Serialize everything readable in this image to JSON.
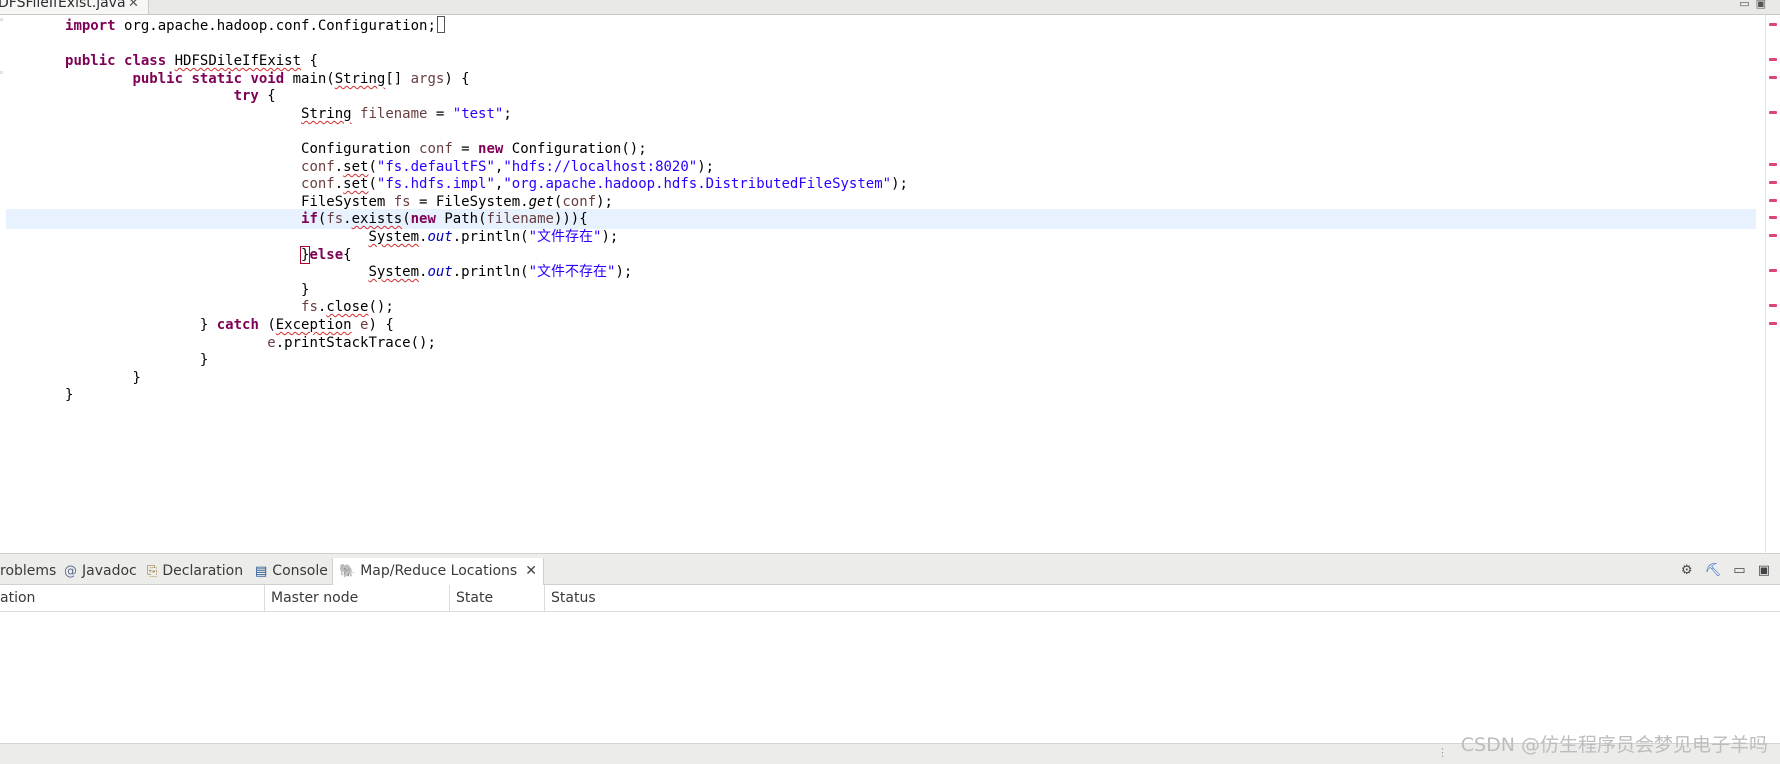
{
  "editor": {
    "tab_label": "DFSFileIfExist.java",
    "close_glyph": "✕",
    "min_max_glyphs": "▭▣",
    "code_lines": [
      {
        "i": 0,
        "parts": [
          [
            "kw",
            "import"
          ],
          [
            "",
            "org.apache.hadoop.conf.Configuration;"
          ]
        ]
      },
      {
        "i": 2,
        "parts": [
          [
            "kw",
            "public class"
          ],
          [
            "",
            ""
          ],
          [
            "sq",
            "HDFSDileIfExist"
          ],
          [
            "",
            " {"
          ]
        ]
      }
    ]
  },
  "code": {
    "l1_kw": "import",
    "l1_txt": " org.apache.hadoop.conf.Configuration;",
    "l3_kw": "public class",
    "l3_cls": "HDFSDileIfExist",
    "l3_end": " {",
    "l4_kw": "public static void",
    "l4_a": " main(",
    "l4_b": "String",
    "l4_c": "[] ",
    "l4_d": "args",
    "l4_e": ") {",
    "l5_kw": "try",
    "l5_e": " {",
    "l6_a": "String",
    "l6_b": "filename",
    "l6_c": " = ",
    "l6_d": "\"test\"",
    "l6_e": ";",
    "l8_a": "Configuration ",
    "l8_b": "conf",
    "l8_c": " = ",
    "l8_d": "new",
    "l8_e": " Configuration();",
    "l9_a": "conf",
    "l9_b": ".",
    "l9_c": "set",
    "l9_d": "(",
    "l9_e": "\"fs.defaultFS\"",
    "l9_f": ",",
    "l9_g": "\"hdfs://localhost:8020\"",
    "l9_h": ");",
    "l10_a": "conf",
    "l10_b": ".",
    "l10_c": "set",
    "l10_d": "(",
    "l10_e": "\"fs.hdfs.impl\"",
    "l10_f": ",",
    "l10_g": "\"org.apache.hadoop.hdfs.DistributedFileSystem\"",
    "l10_h": ");",
    "l11_a": "FileSystem ",
    "l11_b": "fs",
    "l11_c": " = FileSystem.",
    "l11_d": "get",
    "l11_e": "(",
    "l11_f": "conf",
    "l11_g": ");",
    "l12_kw": "if",
    "l12_a": "(",
    "l12_b": "fs",
    "l12_c": ".",
    "l12_d": "exists",
    "l12_e": "(",
    "l12_f": "new",
    "l12_g": " Path(",
    "l12_h": "filename",
    "l12_i": "))){",
    "l13_a": "System",
    "l13_b": ".",
    "l13_c": "out",
    "l13_d": ".println(",
    "l13_e": "\"文件存在\"",
    "l13_f": ");",
    "l14_a": "}",
    "l14_kw": "else",
    "l14_b": "{",
    "l15_a": "System",
    "l15_b": ".",
    "l15_c": "out",
    "l15_d": ".println(",
    "l15_e": "\"文件不存在\"",
    "l15_f": ");",
    "l16": "}",
    "l17_a": "fs",
    "l17_b": ".",
    "l17_c": "close",
    "l17_d": "();",
    "l18_a": "} ",
    "l18_kw": "catch",
    "l18_b": " (",
    "l18_c": "Exception",
    "l18_d": " ",
    "l18_e": "e",
    "l18_f": ") {",
    "l19_a": "e",
    "l19_b": ".printStackTrace();",
    "l20": "}",
    "l21": "}",
    "l22": "}"
  },
  "panel": {
    "tabs": [
      {
        "label": "roblems",
        "icon": ""
      },
      {
        "label": "Javadoc",
        "icon": "@"
      },
      {
        "label": "Declaration",
        "icon": "⎘"
      },
      {
        "label": "Console",
        "icon": "▤"
      },
      {
        "label": "Map/Reduce Locations",
        "icon": "🐘"
      }
    ],
    "close_glyph": "✕",
    "tool_icons": [
      "⚙",
      "⛏",
      "▭",
      "▣"
    ],
    "columns": [
      "ation",
      "Master node",
      "State",
      "Status"
    ]
  },
  "watermark": "CSDN @仿生程序员会梦见电子羊吗",
  "colors": {
    "keyword": "#7f0055",
    "string": "#2a00ff",
    "local_var": "#6a3e3e",
    "field": "#0000c0",
    "current_line": "#e8f2fe",
    "overview_marker": "#e0457a"
  }
}
